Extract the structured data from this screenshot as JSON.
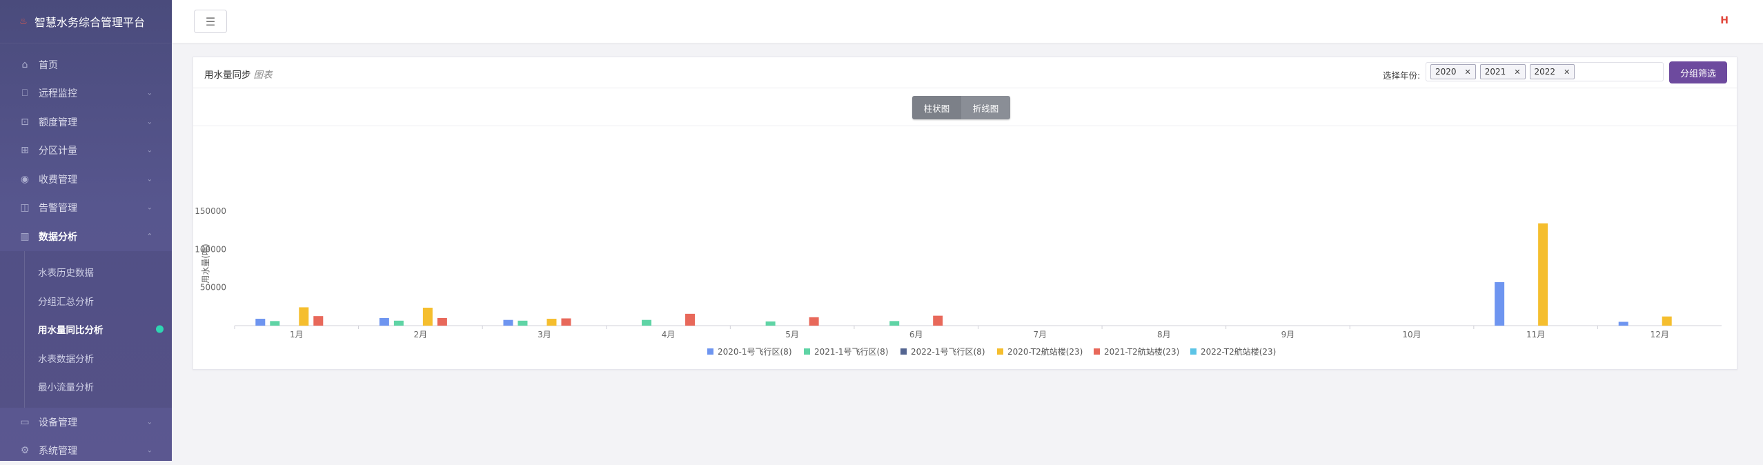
{
  "app": {
    "title": "智慧水务综合管理平台"
  },
  "sidebar": {
    "items": [
      {
        "label": "首页",
        "icon": "home-icon",
        "glyph": "⌂",
        "chevron": false
      },
      {
        "label": "远程监控",
        "icon": "monitor-icon",
        "glyph": "⎕",
        "chevron": true
      },
      {
        "label": "额度管理",
        "icon": "quota-icon",
        "glyph": "⊡",
        "chevron": true
      },
      {
        "label": "分区计量",
        "icon": "grid-icon",
        "glyph": "⊞",
        "chevron": true
      },
      {
        "label": "收费管理",
        "icon": "fee-icon",
        "glyph": "◉",
        "chevron": true
      },
      {
        "label": "告警管理",
        "icon": "alarm-icon",
        "glyph": "◫",
        "chevron": true
      },
      {
        "label": "数据分析",
        "icon": "analysis-icon",
        "glyph": "▥",
        "chevron": true,
        "active": true
      }
    ],
    "submenu": [
      {
        "label": "水表历史数据"
      },
      {
        "label": "分组汇总分析"
      },
      {
        "label": "用水量同比分析",
        "current": true
      },
      {
        "label": "水表数据分析"
      },
      {
        "label": "最小流量分析"
      }
    ],
    "items_after": [
      {
        "label": "设备管理",
        "icon": "device-icon",
        "glyph": "▭",
        "chevron": true
      },
      {
        "label": "系统管理",
        "icon": "settings-icon",
        "glyph": "⚙",
        "chevron": true
      }
    ]
  },
  "card": {
    "title": "用水量同步",
    "title_suffix": "图表",
    "year_label": "选择年份:",
    "selected_years": [
      "2020",
      "2021",
      "2022"
    ],
    "group_button": "分组筛选",
    "toggle": [
      "柱状图",
      "折线图"
    ]
  },
  "chart_data": {
    "type": "bar",
    "ylabel": "用水量(吨)",
    "yticks": [
      50000,
      100000,
      150000
    ],
    "ylim": [
      0,
      150000
    ],
    "categories": [
      "1月",
      "2月",
      "3月",
      "4月",
      "5月",
      "6月",
      "7月",
      "8月",
      "9月",
      "10月",
      "11月",
      "12月"
    ],
    "series": [
      {
        "name": "2020-1号飞行区(8)",
        "color": "#6e95f0",
        "values": [
          9000,
          10000,
          7500,
          0,
          0,
          0,
          0,
          0,
          0,
          0,
          57000,
          5000
        ]
      },
      {
        "name": "2021-1号飞行区(8)",
        "color": "#5fd4a5",
        "values": [
          6000,
          6500,
          6500,
          7500,
          5500,
          6000,
          0,
          0,
          0,
          0,
          0,
          0
        ]
      },
      {
        "name": "2022-1号飞行区(8)",
        "color": "#546591",
        "values": [
          0,
          0,
          0,
          0,
          0,
          0,
          0,
          0,
          0,
          0,
          0,
          0
        ]
      },
      {
        "name": "2020-T2航站楼(23)",
        "color": "#f5be2e",
        "values": [
          24000,
          23500,
          9000,
          0,
          0,
          0,
          0,
          0,
          0,
          0,
          134000,
          12000
        ]
      },
      {
        "name": "2021-T2航站楼(23)",
        "color": "#e8685a",
        "values": [
          12500,
          10000,
          9500,
          15500,
          11000,
          13000,
          0,
          0,
          0,
          0,
          0,
          0
        ]
      },
      {
        "name": "2022-T2航站楼(23)",
        "color": "#5cc4e6",
        "values": [
          0,
          0,
          0,
          0,
          0,
          0,
          0,
          0,
          0,
          0,
          0,
          0
        ]
      }
    ]
  }
}
